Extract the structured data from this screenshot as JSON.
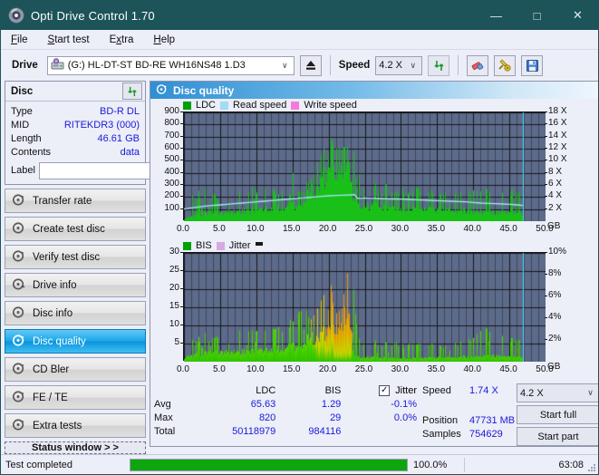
{
  "window": {
    "title": "Opti Drive Control 1.70",
    "icon": "disc-icon",
    "minimize": "—",
    "maximize": "□",
    "close": "✕",
    "titlebar_color": "#1d5459"
  },
  "menu": [
    {
      "label": "File",
      "accel": "F"
    },
    {
      "label": "Start test",
      "accel": "S"
    },
    {
      "label": "Extra",
      "accel": "x"
    },
    {
      "label": "Help",
      "accel": "H"
    }
  ],
  "toolbar": {
    "drive_label": "Drive",
    "drive_value": "(G:)  HL-DT-ST BD-RE  WH16NS48 1.D3",
    "drive_icon": "drive-icon",
    "eject_icon": "eject-icon",
    "speed_label": "Speed",
    "speed_value": "4.2 X",
    "refresh_icon": "refresh-icon",
    "eraser_icon": "eraser-icon",
    "tools_icon": "tools-icon",
    "save_icon": "save-icon",
    "arrow": "∨"
  },
  "disc_panel": {
    "title": "Disc",
    "refresh_icon": "refresh-disc-icon",
    "rows": [
      {
        "key": "Type",
        "value": "BD-R DL"
      },
      {
        "key": "MID",
        "value": "RITEKDR3 (000)"
      },
      {
        "key": "Length",
        "value": "46.61 GB"
      },
      {
        "key": "Contents",
        "value": "data"
      }
    ],
    "label_key": "Label",
    "label_value": "",
    "label_placeholder": "",
    "label_button_icon": "disc-label-icon"
  },
  "nav": {
    "items": [
      {
        "label": "Transfer rate",
        "icon": "disc-test-icon",
        "active": false
      },
      {
        "label": "Create test disc",
        "icon": "disc-burn-icon",
        "active": false
      },
      {
        "label": "Verify test disc",
        "icon": "disc-verify-icon",
        "active": false
      },
      {
        "label": "Drive info",
        "icon": "drive-info-icon",
        "active": false
      },
      {
        "label": "Disc info",
        "icon": "disc-info-icon",
        "active": false
      },
      {
        "label": "Disc quality",
        "icon": "disc-quality-icon",
        "active": true
      },
      {
        "label": "CD Bler",
        "icon": "cd-bler-icon",
        "active": false
      },
      {
        "label": "FE / TE",
        "icon": "fe-te-icon",
        "active": false
      },
      {
        "label": "Extra tests",
        "icon": "extra-tests-icon",
        "active": false
      }
    ],
    "status_window": "Status window > >"
  },
  "main": {
    "title": "Disc quality",
    "icon": "disc-quality-icon"
  },
  "chart_data": [
    {
      "id": "ldc-chart",
      "type": "area",
      "title": "",
      "xlabel": "GB",
      "ylabel": "",
      "legend": [
        {
          "label": "LDC",
          "color": "#00a000"
        },
        {
          "label": "Read speed",
          "color": "#9fdcf5"
        },
        {
          "label": "Write speed",
          "color": "#f77ae0"
        }
      ],
      "legend_position": "top-left",
      "grid": true,
      "xlim": [
        0.0,
        50.0
      ],
      "xticks": [
        "0.0",
        "5.0",
        "10.0",
        "15.0",
        "20.0",
        "25.0",
        "30.0",
        "35.0",
        "40.0",
        "45.0",
        "50.0"
      ],
      "x_unit": "GB",
      "ylim": [
        0,
        900
      ],
      "yticks": [
        "100",
        "200",
        "300",
        "400",
        "500",
        "600",
        "700",
        "800",
        "900"
      ],
      "y2lim": [
        0,
        18
      ],
      "y2ticks": [
        "2 X",
        "4 X",
        "6 X",
        "8 X",
        "10 X",
        "12 X",
        "14 X",
        "16 X",
        "18 X"
      ],
      "series": [
        {
          "name": "LDC",
          "color": "#18c018",
          "kind": "spikes",
          "x": [
            0.0,
            0.4,
            0.8,
            1.2,
            1.6,
            2.0,
            2.4,
            2.8,
            3.0,
            3.2,
            3.6,
            4.0,
            4.4,
            4.8,
            5.2,
            5.6,
            6.0,
            6.4,
            6.8,
            7.2,
            7.6,
            8.0,
            8.4,
            8.8,
            9.2,
            9.6,
            10.0,
            10.4,
            10.8,
            11.2,
            11.6,
            12.0,
            12.4,
            12.8,
            13.2,
            13.6,
            14.0,
            14.4,
            14.8,
            15.0,
            15.4,
            15.8,
            16.2,
            16.6,
            17.0,
            17.4,
            17.8,
            18.2,
            18.6,
            19.0,
            19.4,
            19.8,
            20.2,
            20.6,
            21.0,
            21.4,
            21.8,
            22.2,
            22.6,
            23.0,
            23.4,
            23.8,
            24.2,
            24.6,
            25.0,
            25.6,
            26.2,
            26.8,
            27.4,
            28.0,
            28.6,
            29.2,
            29.8,
            30.4,
            31.0,
            31.6,
            32.2,
            32.8,
            33.4,
            34.0,
            34.6,
            35.2,
            35.8,
            36.4,
            37.0,
            37.6,
            38.2,
            38.8,
            39.4,
            40.0,
            40.6,
            41.2,
            41.8,
            42.4,
            43.0,
            43.6,
            44.2,
            44.8,
            45.4,
            46.0,
            46.6,
            47.0
          ],
          "baseline": [
            20,
            40,
            50,
            55,
            60,
            62,
            65,
            68,
            70,
            72,
            74,
            76,
            78,
            80,
            82,
            85,
            88,
            90,
            92,
            95,
            98,
            100,
            102,
            105,
            108,
            110,
            112,
            115,
            118,
            120,
            122,
            125,
            128,
            130,
            133,
            136,
            140,
            145,
            150,
            155,
            165,
            175,
            190,
            210,
            235,
            265,
            300,
            340,
            380,
            430,
            470,
            510,
            545,
            570,
            585,
            595,
            590,
            570,
            540,
            480,
            190,
            170,
            160,
            155,
            150,
            148,
            146,
            144,
            142,
            140,
            138,
            136,
            134,
            132,
            130,
            128,
            126,
            124,
            122,
            120,
            118,
            116,
            114,
            112,
            110,
            108,
            106,
            104,
            102,
            100,
            98,
            96,
            94,
            92,
            90,
            88,
            86,
            84,
            82,
            80,
            78,
            70
          ],
          "peaks": [
            100,
            220,
            180,
            240,
            200,
            260,
            190,
            230,
            505,
            210,
            180,
            250,
            200,
            170,
            230,
            190,
            260,
            210,
            185,
            300,
            240,
            415,
            230,
            260,
            200,
            390,
            240,
            215,
            190,
            300,
            410,
            230,
            270,
            200,
            250,
            310,
            230,
            270,
            210,
            495,
            290,
            240,
            260,
            300,
            340,
            380,
            420,
            470,
            520,
            560,
            600,
            640,
            680,
            720,
            760,
            820,
            700,
            640,
            620,
            640,
            630,
            280,
            380,
            320,
            300,
            260,
            340,
            290,
            250,
            310,
            270,
            240,
            300,
            280,
            250,
            270,
            290,
            230,
            250,
            270,
            240,
            260,
            280,
            250,
            230,
            270,
            250,
            240,
            260,
            280,
            250,
            230,
            270,
            250,
            240,
            260,
            230,
            250,
            270,
            240,
            220,
            160
          ]
        },
        {
          "name": "Read speed",
          "color": "#a8e4fa",
          "kind": "line",
          "x": [
            0.0,
            1.0,
            2.0,
            3.0,
            4.0,
            5.0,
            6.0,
            7.0,
            8.0,
            9.0,
            10.0,
            11.0,
            12.0,
            13.0,
            14.0,
            15.0,
            16.0,
            17.0,
            18.0,
            19.0,
            20.0,
            21.0,
            22.0,
            23.0,
            23.6,
            24.0,
            25.0,
            26.0,
            27.0,
            28.0,
            29.0,
            30.0,
            31.0,
            32.0,
            33.0,
            34.0,
            35.0,
            36.0,
            37.0,
            38.0,
            39.0,
            40.0,
            41.0,
            42.0,
            43.0,
            44.0,
            45.0,
            46.0,
            46.9
          ],
          "y": [
            2.0,
            2.2,
            2.35,
            2.5,
            2.6,
            2.7,
            2.8,
            2.9,
            3.0,
            3.1,
            3.2,
            3.3,
            3.4,
            3.5,
            3.6,
            3.7,
            3.8,
            3.9,
            4.0,
            4.1,
            4.2,
            4.25,
            4.3,
            4.35,
            4.4,
            3.8,
            3.85,
            3.8,
            3.75,
            3.7,
            3.68,
            3.65,
            3.6,
            3.55,
            3.5,
            3.45,
            3.4,
            3.35,
            3.3,
            3.25,
            3.2,
            3.1,
            3.0,
            2.95,
            2.9,
            2.85,
            2.8,
            2.7,
            2.6
          ]
        }
      ],
      "cursor_x": 46.9,
      "cursor_color": "#4fe0f7"
    },
    {
      "id": "bis-chart",
      "type": "area",
      "title": "",
      "xlabel": "GB",
      "legend": [
        {
          "label": "BIS",
          "color": "#00a000"
        },
        {
          "label": "Jitter",
          "color": "#d9a8e0"
        }
      ],
      "legend_position": "top-left",
      "grid": true,
      "xlim": [
        0.0,
        50.0
      ],
      "xticks": [
        "0.0",
        "5.0",
        "10.0",
        "15.0",
        "20.0",
        "25.0",
        "30.0",
        "35.0",
        "40.0",
        "45.0",
        "50.0"
      ],
      "x_unit": "GB",
      "ylim": [
        0,
        30
      ],
      "yticks": [
        "5",
        "10",
        "15",
        "20",
        "25",
        "30"
      ],
      "y2lim": [
        0,
        10
      ],
      "y2ticks": [
        "2%",
        "4%",
        "6%",
        "8%",
        "10%"
      ],
      "series": [
        {
          "name": "BIS",
          "color": "#3fd000",
          "kind": "spikes",
          "x": [
            0.0,
            0.5,
            1.0,
            1.5,
            2.0,
            2.5,
            3.0,
            3.5,
            4.0,
            4.5,
            5.0,
            5.5,
            6.0,
            6.5,
            7.0,
            7.5,
            8.0,
            8.5,
            9.0,
            9.5,
            10.0,
            10.5,
            11.0,
            11.5,
            12.0,
            12.5,
            13.0,
            13.5,
            14.0,
            14.5,
            15.0,
            15.5,
            16.0,
            16.5,
            17.0,
            17.5,
            18.0,
            18.5,
            19.0,
            19.5,
            20.0,
            20.5,
            21.0,
            21.5,
            22.0,
            22.5,
            23.0,
            23.4,
            24.0,
            24.6,
            25.2,
            25.8,
            26.4,
            27.0,
            27.6,
            28.2,
            28.8,
            29.4,
            30.0,
            30.6,
            31.2,
            31.8,
            32.4,
            33.0,
            33.6,
            34.2,
            34.8,
            35.4,
            36.0,
            36.6,
            37.2,
            37.8,
            38.4,
            39.0,
            39.6,
            40.2,
            40.8,
            41.4,
            42.0,
            42.6,
            43.2,
            43.8,
            44.4,
            45.0,
            45.6,
            46.2,
            46.8
          ],
          "baseline": [
            1.0,
            2.0,
            2.2,
            2.4,
            2.5,
            2.6,
            2.7,
            2.8,
            2.9,
            3.0,
            3.0,
            3.1,
            3.2,
            3.2,
            3.3,
            3.4,
            3.4,
            3.5,
            3.6,
            3.6,
            3.7,
            3.8,
            3.8,
            3.9,
            4.0,
            4.1,
            4.2,
            4.3,
            4.5,
            4.6,
            5.0,
            5.4,
            5.8,
            6.2,
            6.8,
            7.4,
            8.0,
            8.8,
            9.6,
            10.4,
            11.4,
            12.2,
            13.0,
            13.6,
            14.0,
            14.2,
            13.6,
            2.0,
            1.6,
            1.5,
            1.4,
            1.4,
            1.3,
            1.3,
            1.3,
            1.2,
            1.2,
            1.2,
            1.2,
            1.2,
            1.2,
            1.2,
            1.2,
            1.2,
            1.3,
            1.3,
            1.3,
            1.4,
            1.4,
            1.4,
            1.5,
            1.5,
            1.6,
            1.6,
            1.7,
            1.8,
            1.9,
            2.0,
            2.1,
            2.0,
            1.8,
            1.7,
            1.6,
            1.6,
            1.5,
            1.5,
            1.4
          ],
          "peaks": [
            4.5,
            6.0,
            6.5,
            6.0,
            7.0,
            6.5,
            11.0,
            7.0,
            6.5,
            7.0,
            6.5,
            7.5,
            7.0,
            8.0,
            7.5,
            9.0,
            8.5,
            10.5,
            8.0,
            9.0,
            8.5,
            9.5,
            9.0,
            8.5,
            9.5,
            9.0,
            10.0,
            9.5,
            13.0,
            11.0,
            13.0,
            12.5,
            14.5,
            13.0,
            15.0,
            14.0,
            16.0,
            15.5,
            17.5,
            18.5,
            20.0,
            22.0,
            25.5,
            29.0,
            24.0,
            24.5,
            24.0,
            22.0,
            6.5,
            5.5,
            6.0,
            5.5,
            6.0,
            5.5,
            5.0,
            5.5,
            5.0,
            5.5,
            5.0,
            5.0,
            5.5,
            5.0,
            5.0,
            5.5,
            5.5,
            5.0,
            6.5,
            5.5,
            5.0,
            5.5,
            6.0,
            5.5,
            6.0,
            6.5,
            7.0,
            7.5,
            8.0,
            8.5,
            9.5,
            8.0,
            7.5,
            7.0,
            7.5,
            7.0,
            6.5,
            6.0,
            5.0
          ]
        }
      ],
      "gradient_note": "green to orange with increasing error level",
      "cursor_x": 46.9,
      "cursor_color": "#4fe0f7"
    }
  ],
  "stats": {
    "columns": [
      "LDC",
      "BIS"
    ],
    "jitter_label": "Jitter",
    "jitter_checked": true,
    "jitter_check_glyph": "✓",
    "rows": [
      {
        "label": "Avg",
        "ldc": "65.63",
        "bis": "1.29",
        "jitter": "-0.1%"
      },
      {
        "label": "Max",
        "ldc": "820",
        "bis": "29",
        "jitter": "0.0%"
      },
      {
        "label": "Total",
        "ldc": "50118979",
        "bis": "984116",
        "jitter": ""
      }
    ],
    "speed_label": "Speed",
    "speed_value": "1.74 X",
    "position_label": "Position",
    "position_value": "47731 MB",
    "samples_label": "Samples",
    "samples_value": "754629",
    "speed_select": "4.2 X",
    "speed_select_arrow": "∨",
    "start_full": "Start full",
    "start_part": "Start part"
  },
  "statusbar": {
    "message": "Test completed",
    "progress_percent": 100.0,
    "progress_text": "100.0%",
    "elapsed": "63:08",
    "progress_color": "#0ea50e"
  }
}
